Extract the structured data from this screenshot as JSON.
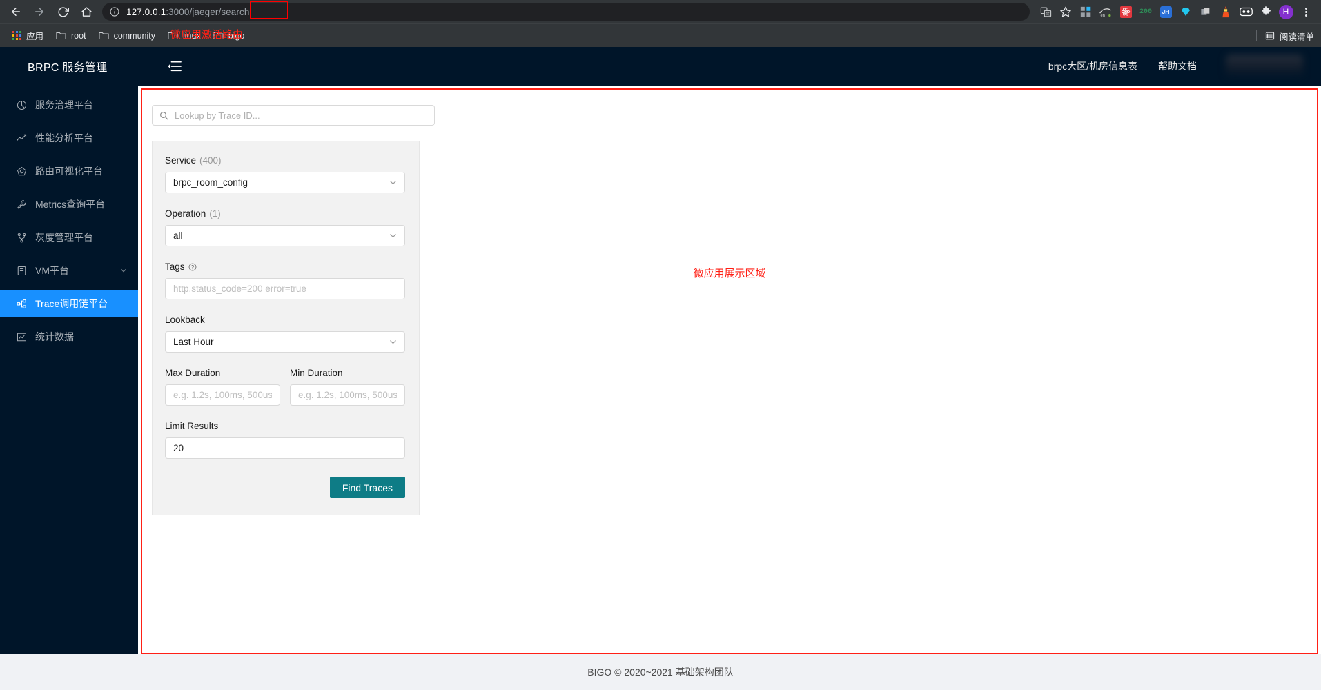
{
  "browser": {
    "nav": {
      "back_icon": "arrow-left-icon",
      "forward_icon": "arrow-right-icon",
      "reload_icon": "reload-icon",
      "home_icon": "home-icon"
    },
    "omnibox": {
      "info_icon": "page-info-icon",
      "url_host": "127.0.0.1",
      "url_rest": ":3000/jaeger/search",
      "translate_icon": "translate-icon",
      "bookmark_star_icon": "star-icon",
      "highlight_color": "#ff0000"
    },
    "extensions": [
      {
        "name": "extension-grid-icon",
        "label": "",
        "color": "#9aa0a6"
      },
      {
        "name": "extension-en-icon",
        "label": "en",
        "color": "#d6d6d6"
      },
      {
        "name": "extension-react-icon",
        "label": "",
        "color": "#e2383f"
      },
      {
        "name": "extension-200-icon",
        "label": "200",
        "color": "#2e6b4a"
      },
      {
        "name": "extension-jh-icon",
        "label": "JH",
        "color": "#2a6fd6"
      },
      {
        "name": "extension-diamond-icon",
        "label": "",
        "color": "#22c7ef"
      },
      {
        "name": "extension-copy-icon",
        "label": "",
        "color": "#b0b0b0"
      },
      {
        "name": "extension-lighthouse-icon",
        "label": "",
        "color": "#f4511e"
      },
      {
        "name": "extension-goggles-icon",
        "label": "",
        "color": "#ffffff"
      },
      {
        "name": "extension-puzzle-icon",
        "label": "",
        "color": "#e8eaed"
      }
    ],
    "profile": {
      "initial": "H",
      "color": "#8430ce"
    },
    "menu_icon": "kebab-menu-icon",
    "bookmarks": [
      {
        "label": "应用",
        "icon": "apps-grid-icon"
      },
      {
        "label": "root",
        "icon": "folder-icon"
      },
      {
        "label": "community",
        "icon": "folder-icon"
      },
      {
        "label": "linux",
        "icon": "folder-icon"
      },
      {
        "label": "bigo",
        "icon": "folder-icon"
      }
    ],
    "bookmark_annotation": "微应用激活路由",
    "reading_list": {
      "label": "阅读清单",
      "icon": "reading-list-icon"
    }
  },
  "app": {
    "logo": "BRPC 服务管理",
    "menu_fold_icon": "menu-fold-icon",
    "header_links": [
      {
        "label": "brpc大区/机房信息表"
      },
      {
        "label": "帮助文档"
      }
    ],
    "sidebar": [
      {
        "label": "服务治理平台",
        "icon": "dashboard-pie-icon",
        "active": false,
        "caret": false
      },
      {
        "label": "性能分析平台",
        "icon": "line-chart-icon",
        "active": false,
        "caret": false
      },
      {
        "label": "路由可视化平台",
        "icon": "routing-node-icon",
        "active": false,
        "caret": false
      },
      {
        "label": "Metrics查询平台",
        "icon": "wrench-icon",
        "active": false,
        "caret": false
      },
      {
        "label": "灰度管理平台",
        "icon": "branch-fork-icon",
        "active": false,
        "caret": false
      },
      {
        "label": "VM平台",
        "icon": "database-icon",
        "active": false,
        "caret": true
      },
      {
        "label": "Trace调用链平台",
        "icon": "cluster-icon",
        "active": true,
        "caret": false
      },
      {
        "label": "统计数据",
        "icon": "area-chart-icon",
        "active": false,
        "caret": false
      }
    ],
    "microapp_annotation": "微应用展示区域",
    "microapp_border_color": "#ff2016",
    "footer": "BIGO © 2020~2021 基础架构团队",
    "accent_active": "#1890ff",
    "sidebar_bg": "#001529"
  },
  "jaeger": {
    "trace_lookup": {
      "placeholder": "Lookup by Trace ID...",
      "value": "",
      "icon": "search-icon"
    },
    "service": {
      "label": "Service",
      "count": "(400)",
      "value": "brpc_room_config",
      "caret_icon": "chevron-down-icon"
    },
    "operation": {
      "label": "Operation",
      "count": "(1)",
      "value": "all",
      "caret_icon": "chevron-down-icon"
    },
    "tags": {
      "label": "Tags",
      "help_icon": "question-circle-icon",
      "placeholder": "http.status_code=200 error=true",
      "value": ""
    },
    "lookback": {
      "label": "Lookback",
      "value": "Last Hour",
      "caret_icon": "chevron-down-icon"
    },
    "max_duration": {
      "label": "Max Duration",
      "placeholder": "e.g. 1.2s, 100ms, 500us",
      "value": ""
    },
    "min_duration": {
      "label": "Min Duration",
      "placeholder": "e.g. 1.2s, 100ms, 500us",
      "value": ""
    },
    "limit_results": {
      "label": "Limit Results",
      "value": "20"
    },
    "find_button": {
      "label": "Find Traces",
      "color": "#0e7c86"
    }
  }
}
